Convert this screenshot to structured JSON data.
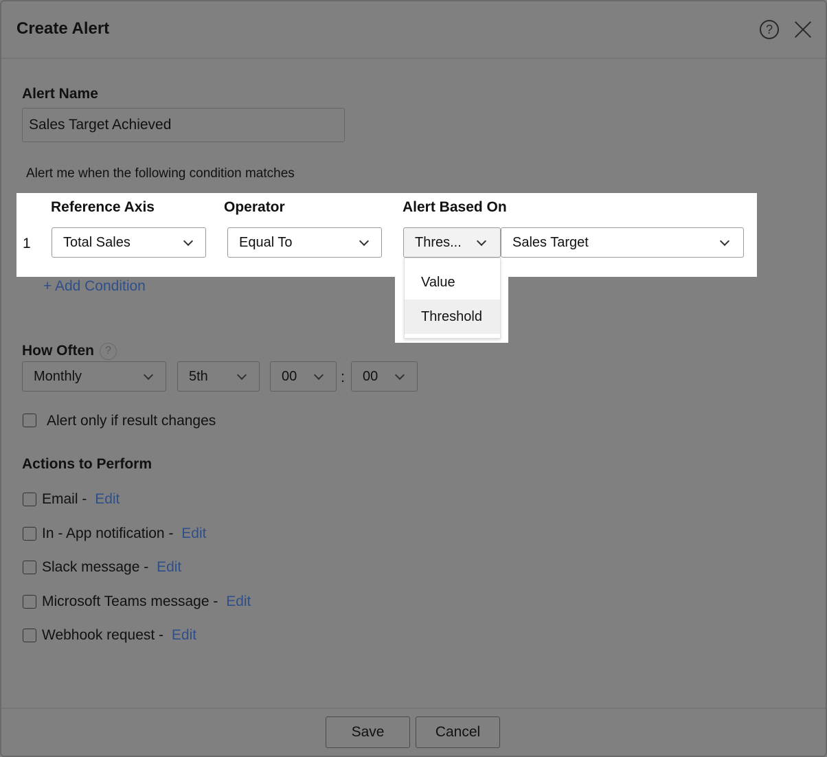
{
  "dialog": {
    "title": "Create Alert",
    "help_icon": "question-circle-icon",
    "close_icon": "close-icon"
  },
  "alert_name": {
    "label": "Alert Name",
    "value": "Sales Target Achieved"
  },
  "condition_intro": "Alert me when the following condition matches",
  "condition": {
    "headers": {
      "reference_axis": "Reference Axis",
      "operator": "Operator",
      "alert_based_on": "Alert Based On"
    },
    "row_number": "1",
    "reference_axis_value": "Total Sales",
    "operator_value": "Equal To",
    "based_on_value": "Thres...",
    "target_value": "Sales Target",
    "based_on_options": [
      "Value",
      "Threshold"
    ],
    "highlighted_option": "Threshold",
    "add_condition_label": "+ Add Condition"
  },
  "how_often": {
    "label": "How Often",
    "help_icon": "question-circle-icon",
    "frequency": "Monthly",
    "day": "5th",
    "hour": "00",
    "separator": ":",
    "minute": "00"
  },
  "alert_if_changes": {
    "label": "Alert only if result changes",
    "checked": false
  },
  "actions": {
    "heading": "Actions to Perform",
    "edit_label": "Edit",
    "items": [
      {
        "label": "Email - ",
        "checked": false
      },
      {
        "label": "In - App notification - ",
        "checked": false
      },
      {
        "label": "Slack message - ",
        "checked": false
      },
      {
        "label": "Microsoft Teams message - ",
        "checked": false
      },
      {
        "label": "Webhook request - ",
        "checked": false
      }
    ]
  },
  "footer": {
    "save_label": "Save",
    "cancel_label": "Cancel"
  },
  "colors": {
    "overlay": "#808080",
    "link": "#2f4f8a",
    "highlight": "#ffffff"
  }
}
